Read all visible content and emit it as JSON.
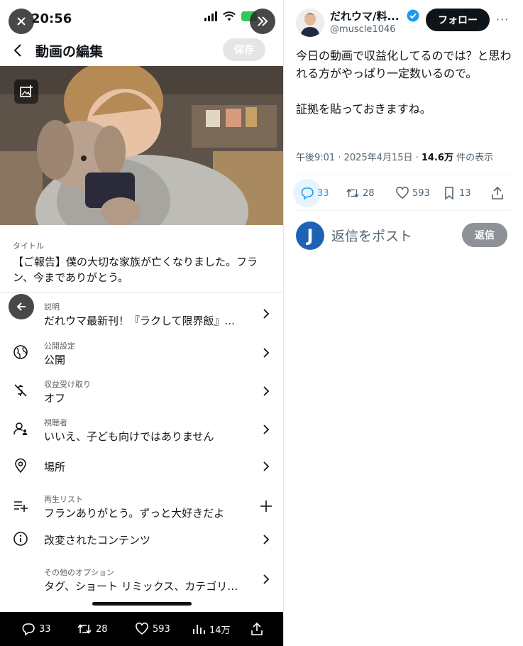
{
  "phone": {
    "status_time": "20:56",
    "header": {
      "title": "動画の編集",
      "save": "保存"
    },
    "video": {
      "title_label": "タイトル",
      "title_text": "【ご報告】僕の大切な家族が亡くなりました。フラン、今までありがとう。"
    },
    "settings": [
      {
        "label": "説明",
        "value": "だれウマ最新刊！『ラクして限界飯』...",
        "icon": "description-icon"
      },
      {
        "label": "公開設定",
        "value": "公開",
        "icon": "globe-icon"
      },
      {
        "label": "収益受け取り",
        "value": "オフ",
        "icon": "monetization-off-icon"
      },
      {
        "label": "視聴者",
        "value": "いいえ、子ども向けではありません",
        "icon": "audience-icon"
      },
      {
        "label": "",
        "value": "場所",
        "icon": "location-icon"
      },
      {
        "label": "再生リスト",
        "value": "フランありがとう。ずっと大好きだよ",
        "icon": "playlist-add-icon"
      },
      {
        "label": "",
        "value": "改変されたコンテンツ",
        "icon": "info-icon"
      },
      {
        "label": "その他のオプション",
        "value": "タグ、ショート リミックス、カテゴリ…",
        "icon": ""
      }
    ],
    "bottom_bar": {
      "replies": "33",
      "reposts": "28",
      "likes": "593",
      "views": "14万"
    }
  },
  "tweet": {
    "author_name": "だれウマ/料...",
    "author_handle": "@muscle1046",
    "follow": "フォロー",
    "more": "···",
    "body": "今日の動画で収益化してるのでは？と思われる方がやっぱり一定数いるので。\n\n証拠を貼っておきますね。",
    "meta_prefix": "午後9:01 · 2025年4月15日 · ",
    "views": "14.6万",
    "views_suffix": " 件の表示",
    "stats": {
      "replies": "33",
      "reposts": "28",
      "likes": "593",
      "bookmarks": "13"
    },
    "reply_avatar_letter": "J",
    "reply_placeholder": "返信をポスト",
    "reply_button": "返信"
  },
  "colors": {
    "verified": "#1d9bf0",
    "reply_highlight": "#1d9bf0",
    "battery": "#34c759"
  }
}
